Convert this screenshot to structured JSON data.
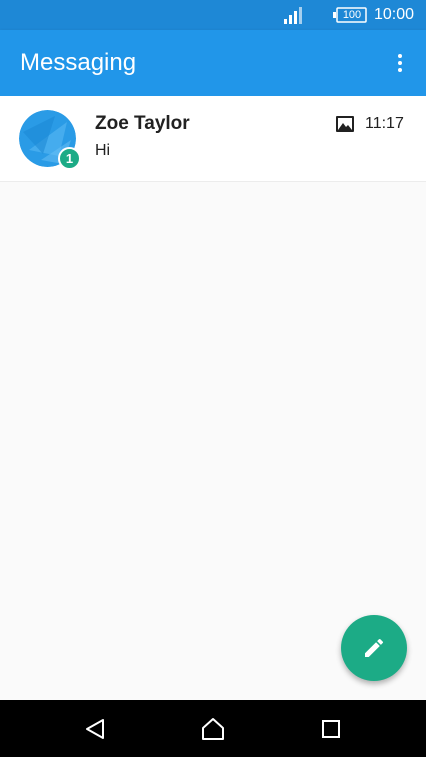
{
  "status_bar": {
    "battery_level": "100",
    "time": "10:00",
    "icons": [
      "signal-icon",
      "battery-icon"
    ]
  },
  "app_bar": {
    "title": "Messaging",
    "overflow_icon": "more-vert-icon"
  },
  "conversations": [
    {
      "name": "Zoe Taylor",
      "snippet": "Hi",
      "time": "11:17",
      "unread_count": "1",
      "attachment_icon": "image-icon"
    }
  ],
  "fab": {
    "icon": "pencil-icon"
  },
  "nav_bar": {
    "icons": [
      "back-icon",
      "home-icon",
      "recents-icon"
    ]
  },
  "colors": {
    "status_bar": "#1e88d6",
    "app_bar": "#2196e9",
    "accent": "#1cab86",
    "background": "#fafafa"
  }
}
